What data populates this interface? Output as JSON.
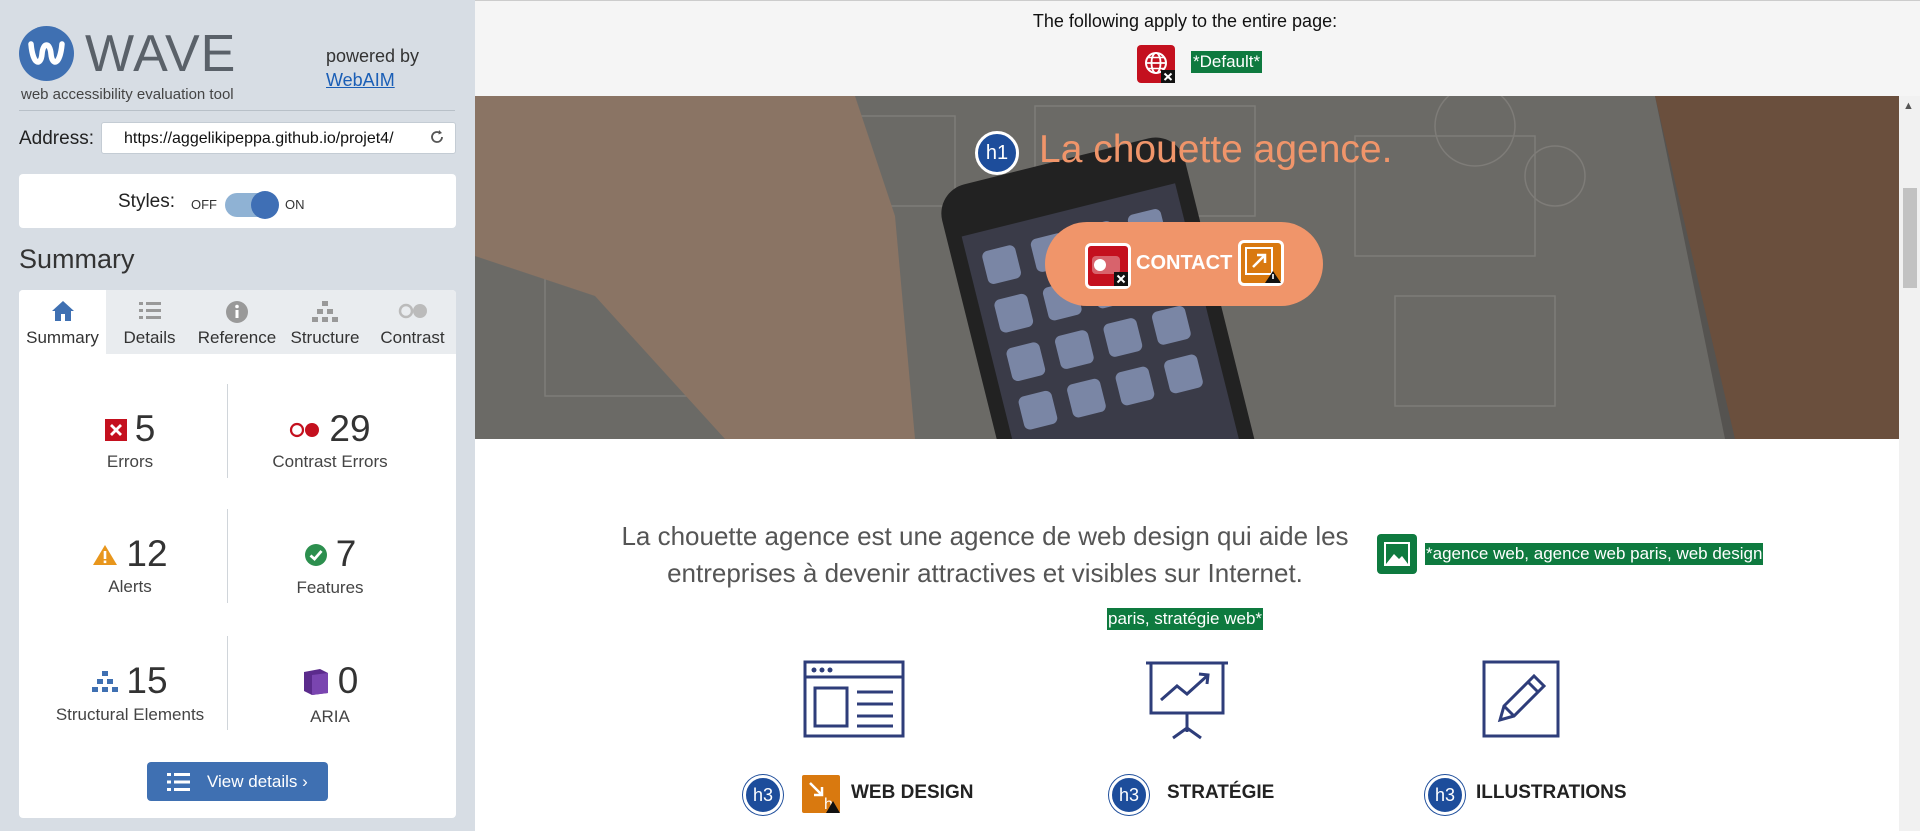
{
  "sidebar": {
    "logo_text": "WAVE",
    "logo_subtitle": "web accessibility evaluation tool",
    "powered_by": "powered by",
    "webaim_link": "WebAIM",
    "address_label": "Address:",
    "address_value": "https://aggelikipeppa.github.io/projet4/",
    "styles_label": "Styles:",
    "styles_off": "OFF",
    "styles_on": "ON",
    "styles_enabled": true,
    "summary_heading": "Summary",
    "tabs": [
      {
        "label": "Summary",
        "icon": "home-icon",
        "active": true
      },
      {
        "label": "Details",
        "icon": "list-icon",
        "active": false
      },
      {
        "label": "Reference",
        "icon": "info-icon",
        "active": false
      },
      {
        "label": "Structure",
        "icon": "hierarchy-icon",
        "active": false
      },
      {
        "label": "Contrast",
        "icon": "contrast-icon",
        "active": false
      }
    ],
    "stats": {
      "errors": {
        "count": "5",
        "label": "Errors",
        "color": "#c4101e"
      },
      "contrast_errors": {
        "count": "29",
        "label": "Contrast Errors",
        "color": "#c4101e"
      },
      "alerts": {
        "count": "12",
        "label": "Alerts",
        "color": "#e8961c"
      },
      "features": {
        "count": "7",
        "label": "Features",
        "color": "#2c8f4e"
      },
      "structural": {
        "count": "15",
        "label": "Structural Elements",
        "color": "#3f70b2"
      },
      "aria": {
        "count": "0",
        "label": "ARIA",
        "color": "#5b2b8c"
      }
    },
    "view_details_label": "View details ›"
  },
  "page": {
    "apply_text": "The following apply to the entire page:",
    "default_label": "*Default*",
    "hero_title": "La chouette agence.",
    "contact_label": "CONTACT",
    "h1_badge": "h1",
    "description": "La chouette agence est une agence de web design qui aide les entreprises à devenir attractives et visibles sur Internet.",
    "alt_text_line1": "*agence web, agence web paris, web design",
    "alt_text_line2": "paris, stratégie web*",
    "services": [
      {
        "badge": "h3",
        "title": "WEB DESIGN",
        "icon": "browser-window-icon"
      },
      {
        "badge": "h3",
        "title": "STRATÉGIE",
        "icon": "presentation-chart-icon"
      },
      {
        "badge": "h3",
        "title": "ILLUSTRATIONS",
        "icon": "pencil-icon"
      }
    ],
    "colors": {
      "accent": "#f0956a",
      "error": "#c4101e",
      "feature_green": "#0e7a3f",
      "structure_blue": "#1d4d9b"
    }
  }
}
